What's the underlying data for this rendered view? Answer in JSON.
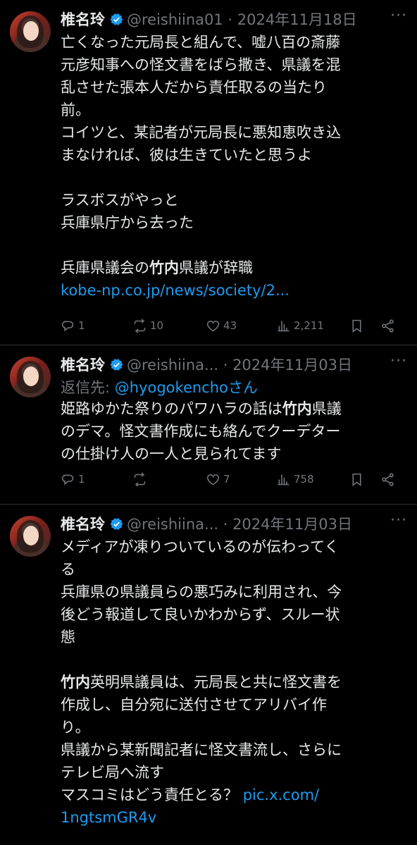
{
  "tweets": [
    {
      "name": "椎名玲",
      "meta": "@reishiina01 · 2024年11月18日",
      "more": "···",
      "reply_to": null,
      "body_lines": [
        "亡くなった元局長と組んで、嘘八百の斎藤",
        "元彦知事への怪文書をばら撒き、県議を混",
        "乱させた張本人だから責任取るの当たり",
        "前。",
        "コイツと、某記者が元局長に悪知恵吹き込",
        "まなければ、彼は生きていたと思うよ",
        "",
        "ラスボスがやっと",
        "兵庫県庁から去った",
        "",
        "兵庫県議会の竹内県議が辞職"
      ],
      "bold_word": "竹内",
      "link": "kobe-np.co.jp/news/society/2...",
      "link_tail": "",
      "counts": {
        "reply": "1",
        "retweet": "10",
        "like": "43",
        "views": "2,211"
      }
    },
    {
      "name": "椎名玲",
      "meta": "@reishiina... · 2024年11月03日",
      "more": "···",
      "reply_to": {
        "prefix": "返信先: ",
        "handle": "@hyogokenchoさん"
      },
      "body_lines": [
        "姫路ゆかた祭りのパワハラの話は竹内県議",
        "のデマ。怪文書作成にも絡んでクーデター",
        "の仕掛け人の一人と見られてます"
      ],
      "bold_word": "竹内",
      "link": "",
      "link_tail": "",
      "counts": {
        "reply": "1",
        "retweet": "",
        "like": "7",
        "views": "758"
      }
    },
    {
      "name": "椎名玲",
      "meta": "@reishiina... · 2024年11月03日",
      "more": "···",
      "reply_to": null,
      "body_lines": [
        "メディアが凍りついているのが伝わってく",
        "る",
        "兵庫県の県議員らの悪巧みに利用され、今",
        "後どう報道して良いかわからず、スルー状",
        "態",
        "",
        "竹内英明県議員は、元局長と共に怪文書を",
        "作成し、自分宛に送付させてアリバイ作",
        "り。",
        "県議から某新聞記者に怪文書流し、さらに",
        "テレビ局へ流す",
        "マスコミはどう責任とる？ "
      ],
      "bold_word": "竹内",
      "link": "pic.x.com/",
      "link_tail": "1ngtsmGR4v",
      "counts": null
    }
  ],
  "colors": {
    "background": "#000000",
    "text": "#e7e9ea",
    "muted": "#71767b",
    "link": "#1d9bf0",
    "verified": "#1d9bf0",
    "divider": "#2f3336"
  },
  "icons": [
    "verified-badge-icon",
    "more-icon",
    "reply-icon",
    "retweet-icon",
    "like-icon",
    "views-icon",
    "bookmark-icon",
    "share-icon"
  ]
}
